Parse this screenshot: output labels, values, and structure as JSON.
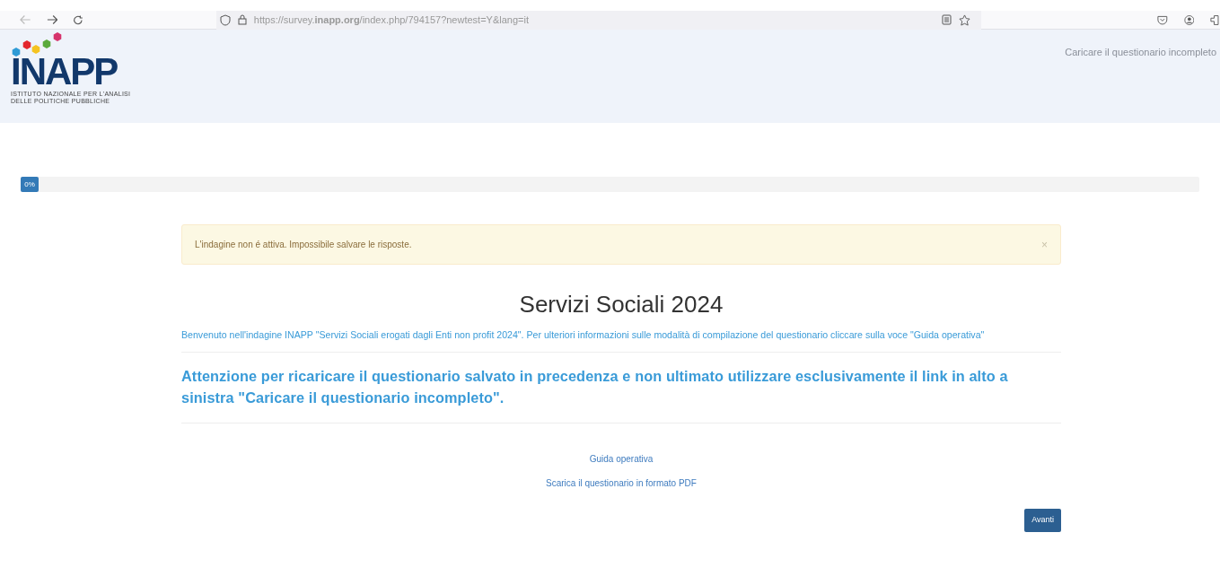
{
  "browser": {
    "url": "https://survey.**inapp.org**/index.php/794157?newtest=Y&lang=it"
  },
  "header": {
    "logo": {
      "name": "INAPP",
      "caption_lines": [
        "ISTITUTO NAZIONALE PER L'ANALISI",
        "DELLE POLITICHE PUBBLICHE"
      ],
      "dots": [
        {
          "color": "#2f9bd6"
        },
        {
          "color": "#e3262d"
        },
        {
          "color": "#f5c320"
        },
        {
          "color": "#5aaa3c"
        },
        {
          "color": "#d6336c"
        }
      ]
    },
    "link": "Caricare il questionario incompleto"
  },
  "progress": {
    "label": "0%",
    "level": 0
  },
  "alert": {
    "text": "L'indagine non é attiva. Impossibile salvare le risposte.",
    "close": "×"
  },
  "title": "Servizi Sociali 2024",
  "intro": "Benvenuto nell'indagine INAPP \"Servizi Sociali erogati dagli Enti non profit 2024\". Per ulteriori informazioni sulle modalità di compilazione del questionario cliccare sulla voce \"Guida operativa\"",
  "notice": "Attenzione per ricaricare il questionario salvato in precedenza e non ultimato utilizzare esclusivamente il link in alto a sinistra \"Caricare il questionario incompleto\".",
  "links": [
    "Guida operativa",
    "Scarica il questionario in formato PDF"
  ],
  "next_button": "Avanti"
}
